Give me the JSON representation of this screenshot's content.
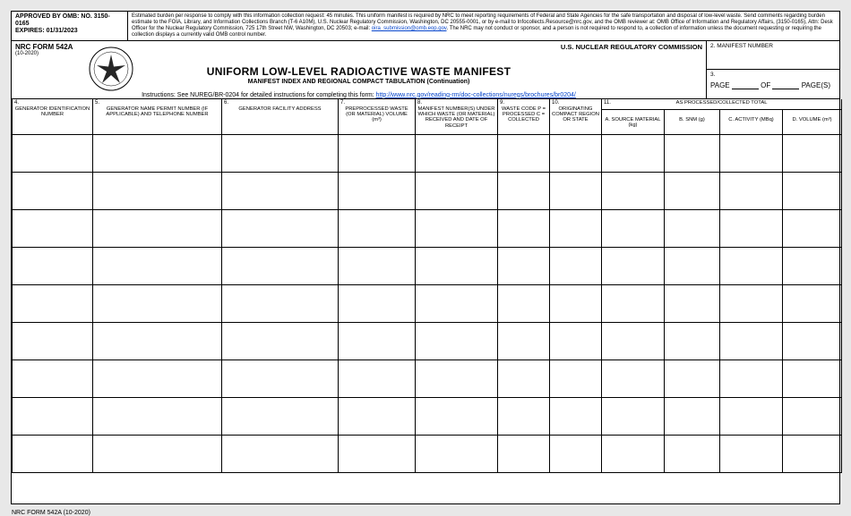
{
  "meta": {
    "omb_line1": "APPROVED BY OMB:",
    "omb_no_label": "NO.",
    "omb_no": "3150-0165",
    "expires_label": "EXPIRES:",
    "expires": "01/31/2023",
    "burden_text_1": "Estimated burden per response to comply with this information collection request: 45 minutes. This uniform manifest is required by NRC to meet reporting requirements of Federal and State Agencies for the safe transportation and disposal of low-level waste. Send comments regarding burden estimate to the FOIA, Library, and Information Collections Branch (T-6 A10M), U.S. Nuclear Regulatory Commission, Washington, DC 20555-0001, or by e-mail to Infocollects.Resource@nrc.gov, and the OMB reviewer at: OMB Office of Information and Regulatory Affairs, (3150-0165), Attn: Desk Officer for the Nuclear Regulatory Commission, 725 17th Street NW, Washington, DC 20503; e-mail: ",
    "burden_email": "oira_submission@omb.eop.gov",
    "burden_text_2": ". The NRC may not conduct or sponsor, and a person is not required to respond to, a collection of information unless the document requesting or requiring the collection displays a currently valid OMB control number."
  },
  "header": {
    "form_number": "NRC FORM 542A",
    "form_date": "(10-2020)",
    "agency": "U.S. NUCLEAR REGULATORY COMMISSION",
    "title": "UNIFORM LOW-LEVEL RADIOACTIVE WASTE MANIFEST",
    "subtitle": "MANIFEST INDEX AND REGIONAL COMPACT TABULATION (Continuation)",
    "instructions_prefix": "Instructions:  See NUREG/BR-0204 for detailed instructions for completing this form:  ",
    "instructions_link": "http://www.nrc.gov/reading-rm/doc-collections/nuregs/brochures/br0204/"
  },
  "right": {
    "box2_num": "2.",
    "box2": "MANIFEST NUMBER",
    "box3_num": "3.",
    "page_label": "PAGE",
    "of_label": "OF",
    "pages_label": "PAGE(S)"
  },
  "cols": {
    "c4n": "4.",
    "c4": "GENERATOR IDENTIFICATION NUMBER",
    "c5n": "5.",
    "c5": "GENERATOR NAME PERMIT NUMBER (IF APPLICABLE) AND TELEPHONE NUMBER",
    "c6n": "6.",
    "c6": "GENERATOR FACILITY ADDRESS",
    "c7n": "7.",
    "c7": "PREPROCESSED WASTE (OR MATERIAL) VOLUME (m³)",
    "c8n": "8.",
    "c8": "MANIFEST NUMBER(S) UNDER WHICH WASTE (OR MATERIAL) RECEIVED AND DATE OF RECEIPT",
    "c9n": "9.",
    "c9": "WASTE CODE P = PROCESSED C = COLLECTED",
    "c10n": "10.",
    "c10": "ORIGINATING COMPACT REGION OR STATE",
    "c11n": "11.",
    "c11": "AS PROCESSED/COLLECTED TOTAL",
    "cA": "A.  SOURCE MATERIAL (kg)",
    "cB": "B.  SNM (g)",
    "cC": "C.  ACTIVITY (MBq)",
    "cD": "D.  VOLUME (m³)"
  },
  "footer": "NRC FORM 542A (10-2020)",
  "rows": [
    {},
    {},
    {},
    {},
    {},
    {},
    {},
    {},
    {}
  ]
}
